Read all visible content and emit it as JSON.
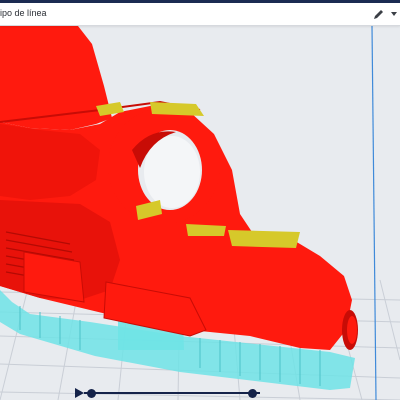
{
  "toolbar": {
    "line_type_label": "ipo de línea",
    "edit_icon": "pencil-icon",
    "dropdown_icon": "caret-down-icon"
  },
  "viewport": {
    "model_color": "#ff1a0e",
    "model_shade_color": "#c80c06",
    "infill_color": "#d6c92a",
    "support_color": "#6fe3e6",
    "build_plate_color": "#e8ebef",
    "grid_color": "#c9ced6",
    "build_volume_line_color": "#3f8ad9"
  },
  "playback": {
    "play_icon": "play-icon",
    "track_color": "#15234a",
    "start_handle_fraction": 0.04,
    "end_handle_fraction": 0.96
  }
}
